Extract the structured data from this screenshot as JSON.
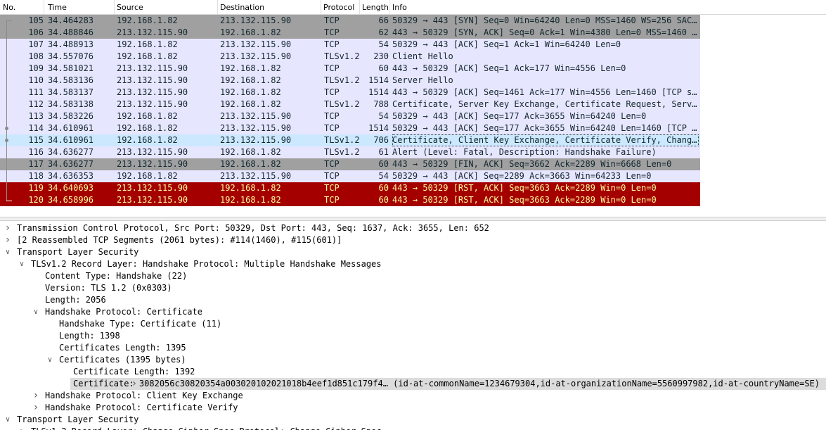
{
  "packet_list": {
    "columns": [
      "No.",
      "Time",
      "Source",
      "Destination",
      "Protocol",
      "Length",
      "Info"
    ],
    "rows": [
      {
        "no": "105",
        "time": "34.464283",
        "src": "192.168.1.82",
        "dst": "213.132.115.90",
        "proto": "TCP",
        "len": "66",
        "info": "50329 → 443 [SYN] Seq=0 Win=64240 Len=0 MSS=1460 WS=256 SACK_PERM",
        "bg": "#a0a0a0",
        "fg": "#12272e"
      },
      {
        "no": "106",
        "time": "34.488846",
        "src": "213.132.115.90",
        "dst": "192.168.1.82",
        "proto": "TCP",
        "len": "62",
        "info": "443 → 50329 [SYN, ACK] Seq=0 Ack=1 Win=4380 Len=0 MSS=1460 SACK_PERM",
        "bg": "#a0a0a0",
        "fg": "#12272e"
      },
      {
        "no": "107",
        "time": "34.488913",
        "src": "192.168.1.82",
        "dst": "213.132.115.90",
        "proto": "TCP",
        "len": "54",
        "info": "50329 → 443 [ACK] Seq=1 Ack=1 Win=64240 Len=0",
        "bg": "#e7e6ff",
        "fg": "#12272e"
      },
      {
        "no": "108",
        "time": "34.557076",
        "src": "192.168.1.82",
        "dst": "213.132.115.90",
        "proto": "TLSv1.2",
        "len": "230",
        "info": "Client Hello",
        "bg": "#e7e6ff",
        "fg": "#12272e"
      },
      {
        "no": "109",
        "time": "34.581021",
        "src": "213.132.115.90",
        "dst": "192.168.1.82",
        "proto": "TCP",
        "len": "60",
        "info": "443 → 50329 [ACK] Seq=1 Ack=177 Win=4556 Len=0",
        "bg": "#e7e6ff",
        "fg": "#12272e"
      },
      {
        "no": "110",
        "time": "34.583136",
        "src": "213.132.115.90",
        "dst": "192.168.1.82",
        "proto": "TLSv1.2",
        "len": "1514",
        "info": "Server Hello",
        "bg": "#e7e6ff",
        "fg": "#12272e"
      },
      {
        "no": "111",
        "time": "34.583137",
        "src": "213.132.115.90",
        "dst": "192.168.1.82",
        "proto": "TCP",
        "len": "1514",
        "info": "443 → 50329 [ACK] Seq=1461 Ack=177 Win=4556 Len=1460 [TCP segment of a reassembled PDU]",
        "bg": "#e7e6ff",
        "fg": "#12272e"
      },
      {
        "no": "112",
        "time": "34.583138",
        "src": "213.132.115.90",
        "dst": "192.168.1.82",
        "proto": "TLSv1.2",
        "len": "788",
        "info": "Certificate, Server Key Exchange, Certificate Request, Server Hello Done",
        "bg": "#e7e6ff",
        "fg": "#12272e"
      },
      {
        "no": "113",
        "time": "34.583226",
        "src": "192.168.1.82",
        "dst": "213.132.115.90",
        "proto": "TCP",
        "len": "54",
        "info": "50329 → 443 [ACK] Seq=177 Ack=3655 Win=64240 Len=0",
        "bg": "#e7e6ff",
        "fg": "#12272e"
      },
      {
        "no": "114",
        "time": "34.610961",
        "src": "192.168.1.82",
        "dst": "213.132.115.90",
        "proto": "TCP",
        "len": "1514",
        "info": "50329 → 443 [ACK] Seq=177 Ack=3655 Win=64240 Len=1460 [TCP segment of a reassembled PDU]",
        "bg": "#e7e6ff",
        "fg": "#12272e"
      },
      {
        "no": "115",
        "time": "34.610961",
        "src": "192.168.1.82",
        "dst": "213.132.115.90",
        "proto": "TLSv1.2",
        "len": "706",
        "info": "Certificate, Client Key Exchange, Certificate Verify, Change Cipher Spec",
        "bg": "#cce8ff",
        "fg": "#12272e"
      },
      {
        "no": "116",
        "time": "34.636277",
        "src": "213.132.115.90",
        "dst": "192.168.1.82",
        "proto": "TLSv1.2",
        "len": "61",
        "info": "Alert (Level: Fatal, Description: Handshake Failure)",
        "bg": "#e7e6ff",
        "fg": "#12272e"
      },
      {
        "no": "117",
        "time": "34.636277",
        "src": "213.132.115.90",
        "dst": "192.168.1.82",
        "proto": "TCP",
        "len": "60",
        "info": "443 → 50329 [FIN, ACK] Seq=3662 Ack=2289 Win=6668 Len=0",
        "bg": "#a0a0a0",
        "fg": "#12272e"
      },
      {
        "no": "118",
        "time": "34.636353",
        "src": "192.168.1.82",
        "dst": "213.132.115.90",
        "proto": "TCP",
        "len": "54",
        "info": "50329 → 443 [ACK] Seq=2289 Ack=3663 Win=64233 Len=0",
        "bg": "#e7e6ff",
        "fg": "#12272e"
      },
      {
        "no": "119",
        "time": "34.640693",
        "src": "213.132.115.90",
        "dst": "192.168.1.82",
        "proto": "TCP",
        "len": "60",
        "info": "443 → 50329 [RST, ACK] Seq=3663 Ack=2289 Win=0 Len=0",
        "bg": "#a40000",
        "fg": "#fffc9c"
      },
      {
        "no": "120",
        "time": "34.658996",
        "src": "213.132.115.90",
        "dst": "192.168.1.82",
        "proto": "TCP",
        "len": "60",
        "info": "443 → 50329 [RST, ACK] Seq=3663 Ack=2289 Win=0 Len=0",
        "bg": "#a40000",
        "fg": "#fffc9c"
      }
    ],
    "selected_no": "115"
  },
  "details": {
    "rows": [
      {
        "level": 0,
        "toggle": "collapsed",
        "text": "Transmission Control Protocol, Src Port: 50329, Dst Port: 443, Seq: 1637, Ack: 3655, Len: 652"
      },
      {
        "level": 0,
        "toggle": "collapsed",
        "text": "[2 Reassembled TCP Segments (2061 bytes): #114(1460), #115(601)]"
      },
      {
        "level": 0,
        "toggle": "expanded",
        "text": "Transport Layer Security"
      },
      {
        "level": 1,
        "toggle": "expanded",
        "text": "TLSv1.2 Record Layer: Handshake Protocol: Multiple Handshake Messages"
      },
      {
        "level": 2,
        "toggle": "none",
        "text": "Content Type: Handshake (22)"
      },
      {
        "level": 2,
        "toggle": "none",
        "text": "Version: TLS 1.2 (0x0303)"
      },
      {
        "level": 2,
        "toggle": "none",
        "text": "Length: 2056"
      },
      {
        "level": 2,
        "toggle": "expanded",
        "text": "Handshake Protocol: Certificate"
      },
      {
        "level": 3,
        "toggle": "none",
        "text": "Handshake Type: Certificate (11)"
      },
      {
        "level": 3,
        "toggle": "none",
        "text": "Length: 1398"
      },
      {
        "level": 3,
        "toggle": "none",
        "text": "Certificates Length: 1395"
      },
      {
        "level": 3,
        "toggle": "expanded",
        "text": "Certificates (1395 bytes)"
      },
      {
        "level": 4,
        "toggle": "none",
        "text": "Certificate Length: 1392"
      },
      {
        "level": 4,
        "toggle": "collapsed",
        "text": "Certificate: 3082056c30820354a003020102021018b4eef1d851c179f4… (id-at-commonName=1234679304,id-at-organizationName=5560997982,id-at-countryName=SE)",
        "highlight": true
      },
      {
        "level": 2,
        "toggle": "collapsed",
        "text": "Handshake Protocol: Client Key Exchange"
      },
      {
        "level": 2,
        "toggle": "collapsed",
        "text": "Handshake Protocol: Certificate Verify"
      },
      {
        "level": 0,
        "toggle": "expanded",
        "text": "Transport Layer Security"
      },
      {
        "level": 1,
        "toggle": "collapsed",
        "text": "TLSv1.2 Record Layer: Change Cipher Spec Protocol: Change Cipher Spec"
      }
    ]
  }
}
